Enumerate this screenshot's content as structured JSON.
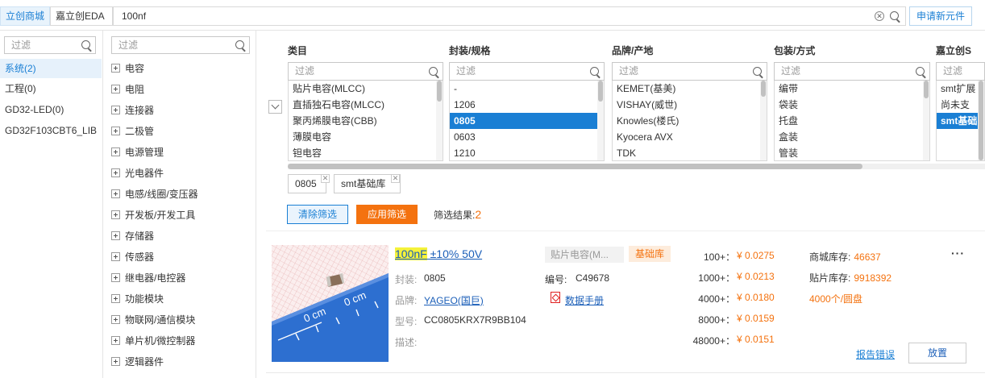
{
  "tabs": [
    {
      "label": "立创商城",
      "active": true
    },
    {
      "label": "嘉立创EDA",
      "active": false
    }
  ],
  "search": {
    "value": "100nf"
  },
  "apply_new_label": "申请新元件",
  "filter_placeholder": "过滤",
  "projects": [
    {
      "label": "系统(2)",
      "active": true
    },
    {
      "label": "工程(0)",
      "active": false
    },
    {
      "label": "GD32-LED(0)",
      "active": false
    },
    {
      "label": "GD32F103CBT6_LIB",
      "active": false
    }
  ],
  "categories": [
    "电容",
    "电阻",
    "连接器",
    "二极管",
    "电源管理",
    "光电器件",
    "电感/线圈/变压器",
    "开发板/开发工具",
    "存储器",
    "传感器",
    "继电器/电控器",
    "功能模块",
    "物联网/通信模块",
    "单片机/微控制器",
    "逻辑器件"
  ],
  "filter_columns": [
    {
      "title": "类目",
      "options": [
        "贴片电容(MLCC)",
        "直插独石电容(MLCC)",
        "聚丙烯膜电容(CBB)",
        "薄膜电容",
        "钽电容"
      ],
      "selected": -1
    },
    {
      "title": "封装/规格",
      "options": [
        "-",
        "1206",
        "0805",
        "0603",
        "1210"
      ],
      "selected": 2
    },
    {
      "title": "品牌/产地",
      "options": [
        "KEMET(基美)",
        "VISHAY(威世)",
        "Knowles(楼氏)",
        "Kyocera AVX",
        "TDK"
      ],
      "selected": -1
    },
    {
      "title": "包装/方式",
      "options": [
        "编带",
        "袋装",
        "托盘",
        "盒装",
        "管装"
      ],
      "selected": -1
    },
    {
      "title": "嘉立创S",
      "options": [
        "smt扩展",
        "尚未支",
        "smt基础"
      ],
      "selected": 2
    }
  ],
  "active_filters": [
    "0805",
    "smt基础库"
  ],
  "clear_filter_label": "清除筛选",
  "apply_filter_label": "应用筛选",
  "result_label": "筛选结果:",
  "result_count": "2",
  "product": {
    "name_highlight": "100nF",
    "name_rest": " ±10% 50V",
    "type": "贴片电容(M...",
    "badge": "基础库",
    "package_label": "封装:",
    "package": "0805",
    "code_label": "编号:",
    "code": "C49678",
    "brand_label": "品牌:",
    "brand": "YAGEO(国巨)",
    "datasheet": "数据手册",
    "model_label": "型号:",
    "model": "CC0805KRX7R9BB104",
    "desc_label": "描述:",
    "price_tiers": [
      {
        "qty": "100+：",
        "price": "¥ 0.0275"
      },
      {
        "qty": "1000+：",
        "price": "¥ 0.0213"
      },
      {
        "qty": "4000+：",
        "price": "¥ 0.0180"
      },
      {
        "qty": "8000+：",
        "price": "¥ 0.0159"
      },
      {
        "qty": "48000+：",
        "price": "¥ 0.0151"
      }
    ],
    "mall_stock_label": "商城库存:",
    "mall_stock": "46637",
    "smt_stock_label": "贴片库存:",
    "smt_stock": "9918392",
    "reel_qty": "4000",
    "reel_unit": "个/圆盘",
    "more": "···",
    "report_label": "报告错误",
    "place_label": "放置"
  },
  "ruler_text": [
    "0 cm",
    "0 cm"
  ],
  "colors": {
    "accent": "#1a7fd4",
    "orange": "#f4720f",
    "selected_bg": "#1a7fd4"
  }
}
